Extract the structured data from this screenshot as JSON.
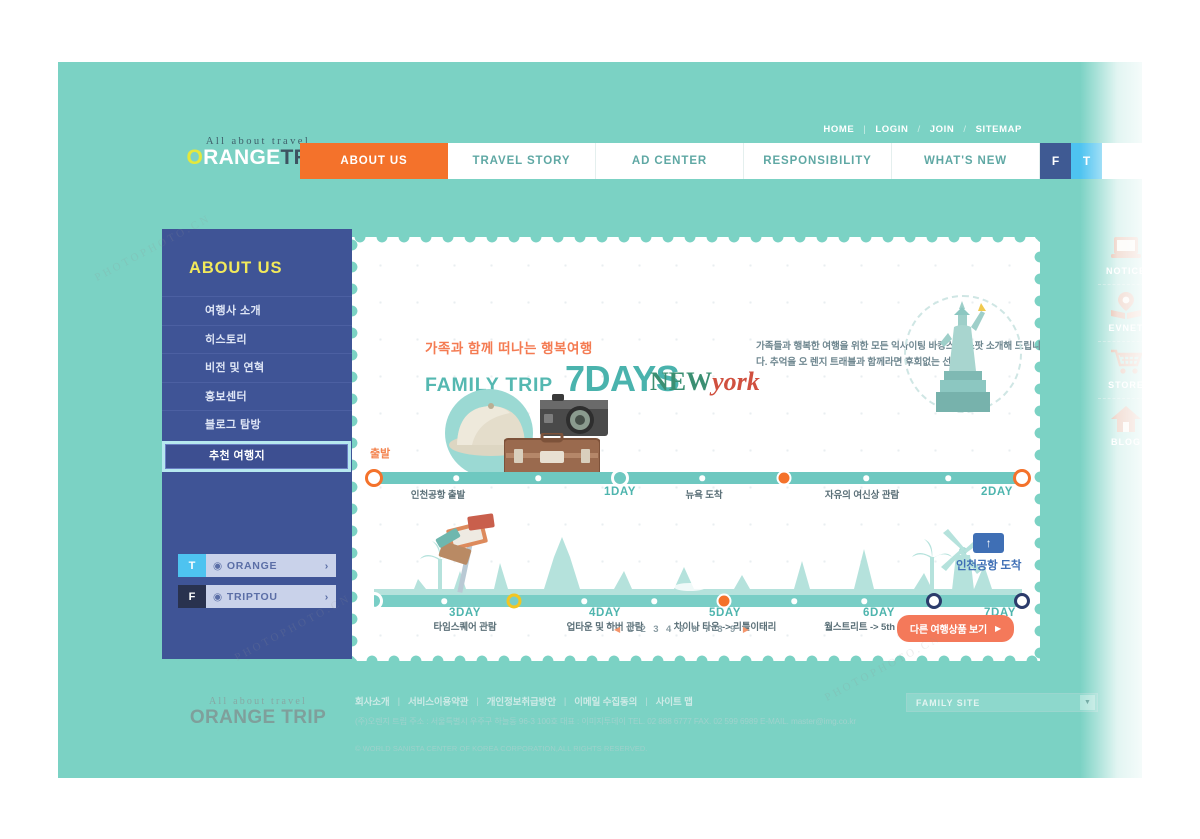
{
  "brand": {
    "tagline": "All about travel",
    "name_o": "O",
    "name_range": "RANGE",
    "name_trip": "TRIP",
    "footer_name": "ORANGE TRIP"
  },
  "util_nav": {
    "items": [
      "HOME",
      "LOGIN",
      "JOIN",
      "SITEMAP"
    ],
    "sep1": "|",
    "sep2": "/",
    "sep3": "/"
  },
  "main_nav": {
    "items": [
      {
        "label": "ABOUT US",
        "active": true
      },
      {
        "label": "TRAVEL STORY",
        "active": false
      },
      {
        "label": "AD CENTER",
        "active": false
      },
      {
        "label": "RESPONSIBILITY",
        "active": false
      },
      {
        "label": "WHAT'S NEW",
        "active": false
      }
    ],
    "facebook": "F",
    "twitter": "T"
  },
  "sidebar": {
    "title": "ABOUT US",
    "items": [
      {
        "label": "여행사 소개"
      },
      {
        "label": "히스토리"
      },
      {
        "label": "비전 및 연혁"
      },
      {
        "label": "홍보센터"
      },
      {
        "label": "블로그 탐방"
      },
      {
        "label": "추천 여행지"
      }
    ],
    "social": [
      {
        "badge": "T",
        "label": "ORANGE",
        "chevron": "›"
      },
      {
        "badge": "F",
        "label": "TRIPTOU",
        "chevron": "›"
      }
    ]
  },
  "banner": {
    "headline_kr": "가족과 함께 떠나는 행복여행",
    "headline_en": "FAMILY TRIP",
    "headline_days": "7DAYS",
    "description": "가족들과 행복한 여행을 위한 모든 익사이팅 바캉스 핫스팟 소개해 드립니다. 추억을 오 렌지 트래블과 함께라면 후회없는 선택!",
    "wordmark_new": "NEW",
    "wordmark_york": "york",
    "depart_label": "출발",
    "arrive_label": "인천공항 도착",
    "arrive_icon": "up-arrow"
  },
  "timeline_row1": [
    {
      "day": "",
      "text": "인천공항 출발"
    },
    {
      "day": "1DAY",
      "text": ""
    },
    {
      "day": "",
      "text": "뉴욕 도착"
    },
    {
      "day": "",
      "text": "자유의 여신상 관람"
    },
    {
      "day": "2DAY",
      "text": ""
    }
  ],
  "timeline_row2": [
    {
      "day": "3DAY",
      "text": "타임스퀘어 관람"
    },
    {
      "day": "4DAY",
      "text": "업타운 및 하버 관람"
    },
    {
      "day": "5DAY",
      "text": "차이나 타운 -> 리틀이태리"
    },
    {
      "day": "6DAY",
      "text": "월스트리트 -> 5th Ave 쇼핑"
    },
    {
      "day": "7DAY",
      "text": ""
    }
  ],
  "pagination": {
    "prev": "◀",
    "next": "▶",
    "pages": [
      "1",
      "2",
      "3",
      "4",
      "5",
      "6",
      "7",
      "8",
      "9"
    ]
  },
  "cta": {
    "label": "다른 여행상품 보기",
    "arrow": "▶"
  },
  "quick_menu": [
    {
      "label": "NOTICE",
      "icon": "laptop-icon"
    },
    {
      "label": "EVNET",
      "icon": "book-pin-icon"
    },
    {
      "label": "STORE",
      "icon": "shopping-cart-icon"
    },
    {
      "label": "BLOG",
      "icon": "house-icon"
    }
  ],
  "footer": {
    "tagline": "All about travel",
    "links": [
      "회사소개",
      "서비스이용약관",
      "개인정보취급방안",
      "이메일 수집동의",
      "사이트 맵"
    ],
    "separator": "|",
    "address": "(주)오렌지 트립  주소 : 서울특별시 우주구 하늘동 96-3 100호  대표 : 이미지투데이  TEL. 02 888 6777  FAX. 02 599 6989  E-MAIL. master@img.co.kr",
    "copyright": "© WORLD SANISTA CENTER OF KOREA CORPORATION,ALL RIGHTS RESERVED.",
    "family_site": "FAMILY SITE",
    "family_arrow": "▼"
  },
  "colors": {
    "teal_bg": "#7bd2c4",
    "orange_accent": "#f4722b",
    "navy_sidebar": "#3f5496",
    "yellow_title": "#f2e95b",
    "teal_text": "#4fb5ae",
    "facebook_blue": "#3f5a93",
    "twitter_blue": "#4ec3f0"
  },
  "watermarks": [
    "PHOTOPHOTO.CN",
    "PHOTOPHOTO.CN",
    "PHOTOPHOTO.CN"
  ]
}
